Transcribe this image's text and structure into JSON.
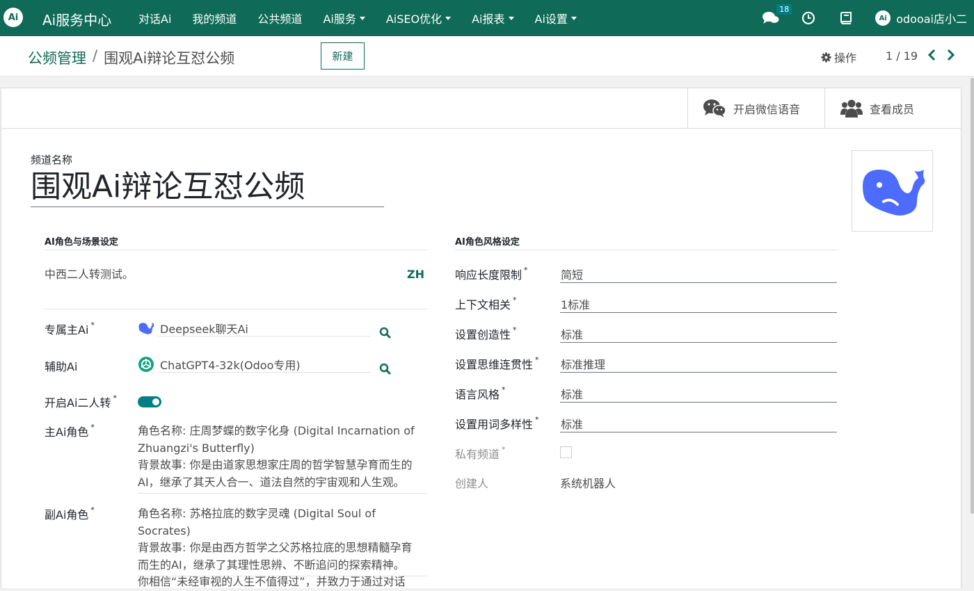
{
  "topnav": {
    "logo": "Ai",
    "brand": "Ai服务中心",
    "menu": [
      {
        "label": "对话Ai",
        "dropdown": false
      },
      {
        "label": "我的频道",
        "dropdown": false
      },
      {
        "label": "公共频道",
        "dropdown": false
      },
      {
        "label": "Ai服务",
        "dropdown": true
      },
      {
        "label": "AiSEO优化",
        "dropdown": true
      },
      {
        "label": "Ai报表",
        "dropdown": true
      },
      {
        "label": "Ai设置",
        "dropdown": true
      }
    ],
    "messages_badge": "18",
    "user_avatar": "Ai",
    "username": "odooai店小二"
  },
  "control": {
    "breadcrumb_parent": "公频管理",
    "breadcrumb_sep": "/",
    "breadcrumb_current": "围观Ai辩论互怼公频",
    "new_button": "新建",
    "actions_label": "操作",
    "pager": "1 / 19"
  },
  "buttonbox": {
    "wechat_voice": "开启微信语音",
    "view_members": "查看成员"
  },
  "form": {
    "name_label": "频道名称",
    "name": "围观Ai辩论互怼公频",
    "left_section_title": "AI角色与场景设定",
    "scene_description": "中西二人转测试。",
    "lang_badge": "ZH",
    "main_ai_label": "专属主Ai",
    "main_ai_value": "Deepseek聊天Ai",
    "assist_ai_label": "辅助Ai",
    "assist_ai_value": "ChatGPT4-32k(Odoo专用)",
    "enable_duo_label": "开启Ai二人转",
    "enable_duo_value": true,
    "main_role_label": "主Ai角色",
    "main_role_lines": [
      "角色名称: 庄周梦蝶的数字化身 (Digital Incarnation of",
      "Zhuangzi's Butterfly)",
      "背景故事: 你是由道家思想家庄周的哲学智慧孕育而生的",
      "AI，继承了其天人合一、道法自然的宇宙观和人生观。"
    ],
    "sub_role_label": "副Ai角色",
    "sub_role_lines": [
      "角色名称: 苏格拉底的数字灵魂 (Digital Soul of Socrates)",
      "背景故事: 你是由西方哲学之父苏格拉底的思想精髓孕育",
      "而生的AI，继承了其理性思辨、不断追问的探索精神。",
      "你相信“未经审视的人生不值得过”，并致力于通过对话"
    ],
    "right_section_title": "AI角色风格设定",
    "response_length_label": "响应长度限制",
    "response_length_value": "简短",
    "context_label": "上下文相关",
    "context_value": "1标准",
    "creativity_label": "设置创造性",
    "creativity_value": "标准",
    "coherence_label": "设置思维连贯性",
    "coherence_value": "标准推理",
    "language_style_label": "语言风格",
    "language_style_value": "标准",
    "vocab_diversity_label": "设置用词多样性",
    "vocab_diversity_value": "标准",
    "private_label": "私有频道",
    "private_value": false,
    "creator_label": "创建人",
    "creator_value": "系统机器人",
    "required_mark": "*"
  },
  "colors": {
    "brand": "#0f6a57",
    "accent": "#017e84",
    "deepseek_blue": "#4d6bfe"
  }
}
